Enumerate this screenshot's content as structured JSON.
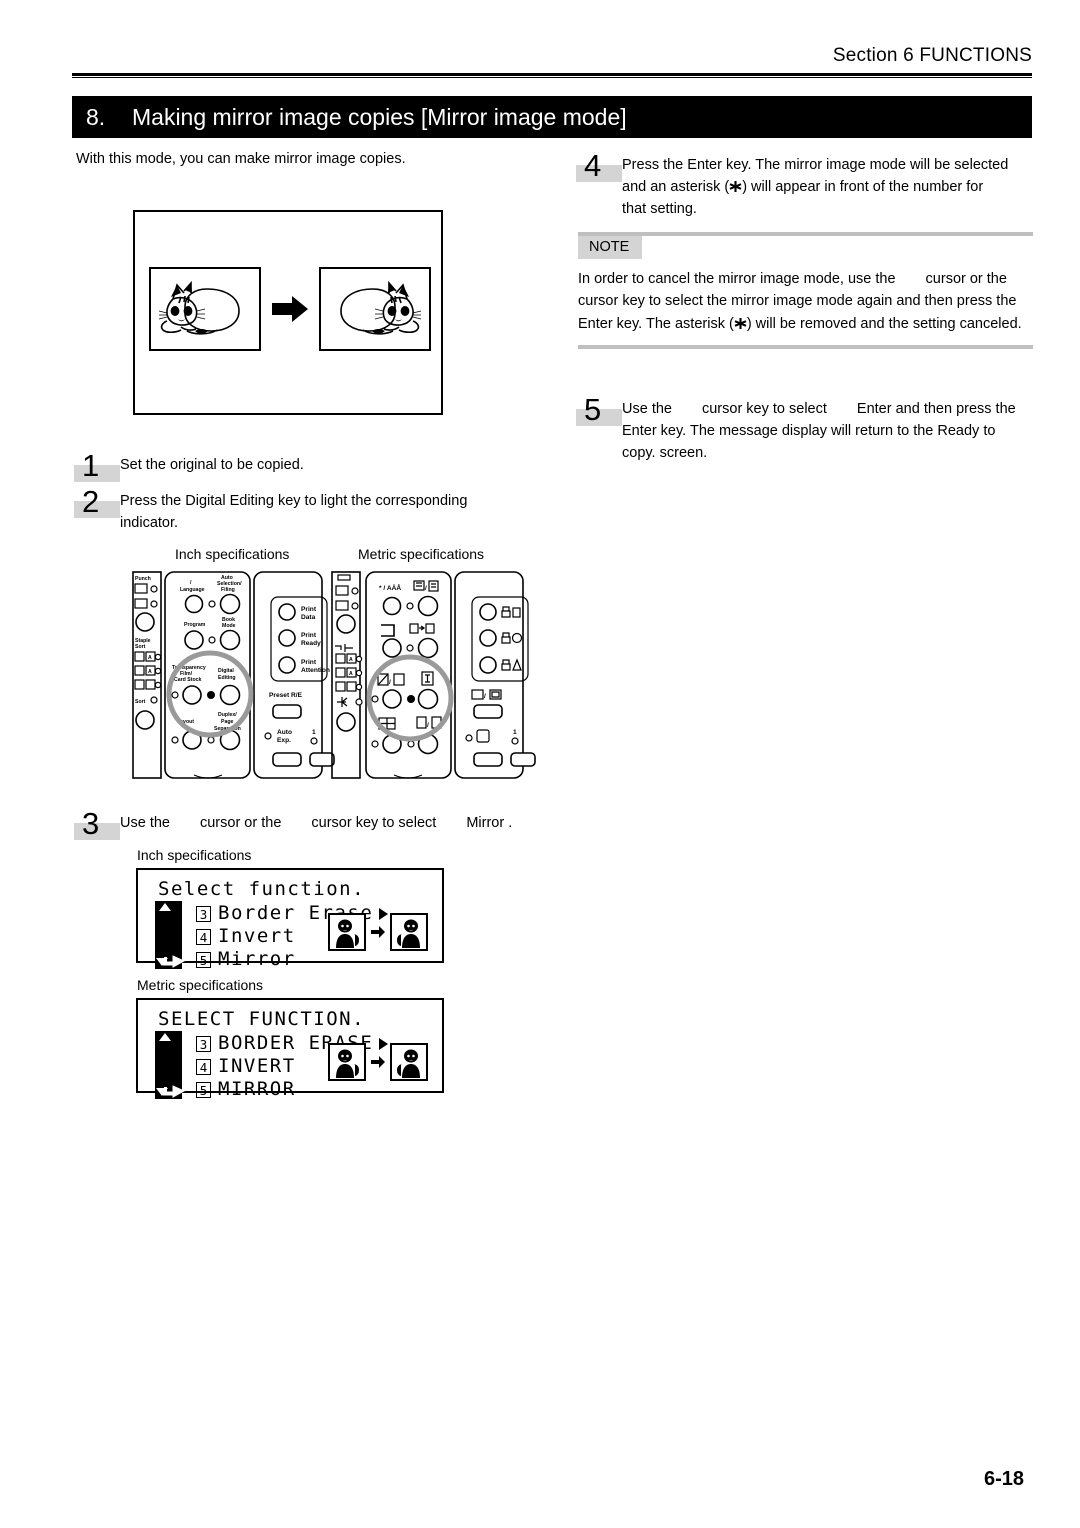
{
  "header": {
    "section_label": "Section 6  FUNCTIONS"
  },
  "title_bar": {
    "number": "8.",
    "text": "Making mirror image copies [Mirror image mode]"
  },
  "intro": {
    "text": "With this mode, you can make mirror image copies."
  },
  "steps": {
    "step1": {
      "num": "1",
      "text": "Set the original to be copied."
    },
    "step2": {
      "num": "2",
      "text": "Press the Digital Editing key to light the corresponding indicator."
    },
    "step3": {
      "num": "3",
      "part1": "Use the",
      "part2": "cursor or the",
      "part3": "cursor key to select",
      "part4": "Mirror ."
    },
    "step4": {
      "num": "4",
      "line1": "Press the Enter key. The mirror image mode will be selected",
      "line2_a": "and an asterisk (",
      "line2_b": ") will appear in front of the number for",
      "line3": "that setting."
    },
    "step5": {
      "num": "5",
      "part1": "Use the",
      "part2": "cursor key to select",
      "part3": "Enter  and then press the",
      "line2": "Enter key. The message display will return to the  Ready to",
      "line3": "copy.  screen."
    }
  },
  "note": {
    "label": "NOTE",
    "line1_a": "In order to cancel the mirror image mode, use the",
    "line1_b": "cursor or the",
    "line2": "cursor key to select the mirror image mode again and then press the",
    "line3_a": "Enter key. The asterisk (",
    "line3_b": ") will be removed and the setting canceled."
  },
  "captions": {
    "inch_panel": "Inch specifications",
    "metric_panel": "Metric specifications",
    "inch_lcd": "Inch specifications",
    "metric_lcd": "Metric specifications"
  },
  "lcd_inch": {
    "title": "Select function.",
    "rows": [
      {
        "num": "3",
        "label": "Border Erase",
        "arrow": true
      },
      {
        "num": "4",
        "label": "Invert",
        "arrow": false
      },
      {
        "num": "5",
        "label": "Mirror",
        "arrow": false
      }
    ]
  },
  "lcd_metric": {
    "title": "SELECT FUNCTION.",
    "rows": [
      {
        "num": "3",
        "label": "BORDER ERASE",
        "arrow": true
      },
      {
        "num": "4",
        "label": "INVERT",
        "arrow": false
      },
      {
        "num": "5",
        "label": "MIRROR",
        "arrow": false
      }
    ]
  },
  "panel_inch": {
    "labels": {
      "punch": "Punch",
      "staple_sort": "Staple\nSort",
      "sort": "Sort",
      "language": "/\nLanguage",
      "auto_selection": "Auto\nSelection/\nFiling",
      "program": "Program",
      "book_mode": "Book\nMode",
      "transparency": "Transparency\nFilm/\nCard Stock",
      "digital_editing": "Digital\nEditing",
      "layout": "Layout",
      "duplex_page": "Duplex/\nPage\nSeparation",
      "print_data": "Print\nData",
      "print_ready": "Print\nReady",
      "print_attention": "Print\nAttention",
      "preset": "Preset R/E",
      "auto_exp": "Auto\nExp.",
      "one": "1"
    }
  },
  "panel_metric": {
    "labels": {
      "lang": "* / AÄÅ",
      "one": "1"
    }
  },
  "footer": {
    "page_number": "6-18"
  },
  "colors": {
    "chip_gray": "#d4d4d4",
    "rule_gray": "#bfbfbf",
    "ink": "#000000",
    "paper": "#ffffff"
  }
}
